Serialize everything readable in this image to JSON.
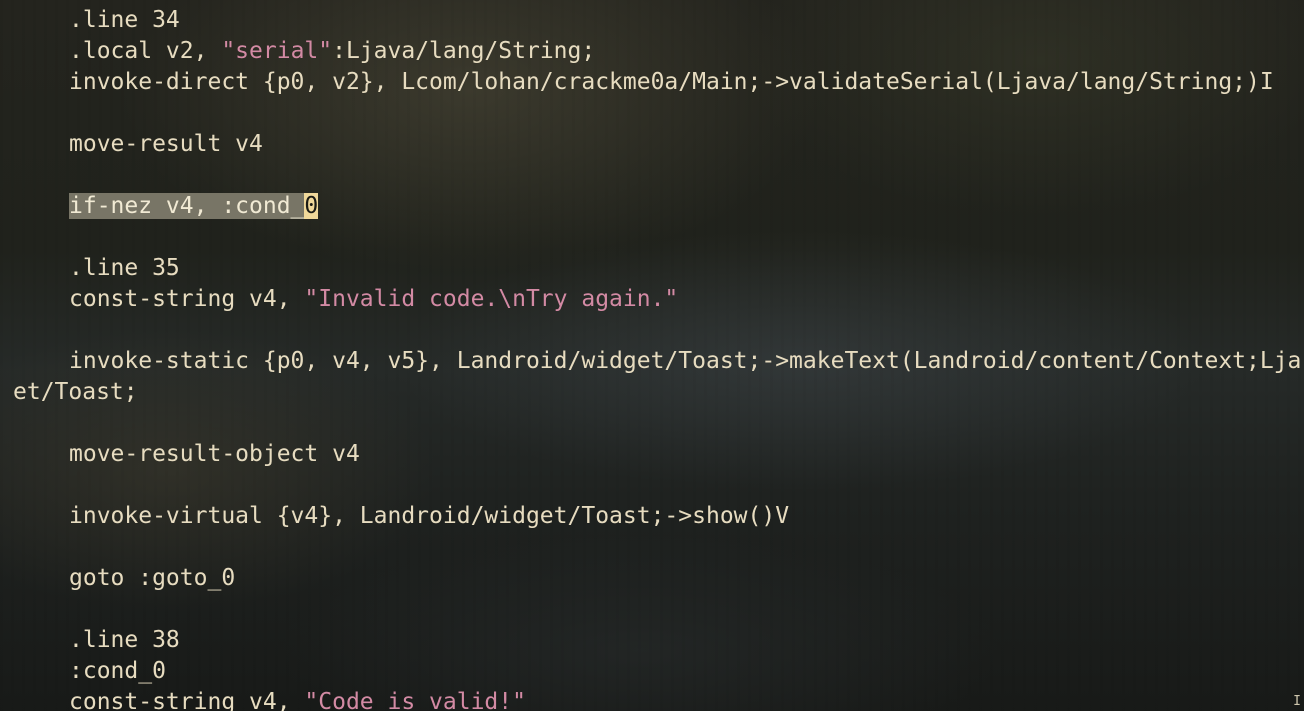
{
  "editor": {
    "lines": [
      {
        "text": ".line 34"
      },
      {
        "pre": ".local v2, ",
        "str": "\"serial\"",
        "post": ":Ljava/lang/String;"
      },
      {
        "text": "invoke-direct {p0, v2}, Lcom/lohan/crackme0a/Main;->validateSerial(Ljava/lang/String;)I"
      },
      {
        "text": ""
      },
      {
        "text": "move-result v4"
      },
      {
        "text": ""
      },
      {
        "selected": "if-nez v4, :cond_",
        "cursor": "0"
      },
      {
        "text": ""
      },
      {
        "text": ".line 35"
      },
      {
        "pre": "const-string v4, ",
        "str": "\"Invalid code.\\nTry again.\"",
        "post": ""
      },
      {
        "text": ""
      },
      {
        "text": "invoke-static {p0, v4, v5}, Landroid/widget/Toast;->makeText(Landroid/content/Context;Lja"
      },
      {
        "text": "et/Toast;"
      },
      {
        "text": ""
      },
      {
        "text": "move-result-object v4"
      },
      {
        "text": ""
      },
      {
        "text": "invoke-virtual {v4}, Landroid/widget/Toast;->show()V"
      },
      {
        "text": ""
      },
      {
        "text": "goto :goto_0"
      },
      {
        "text": ""
      },
      {
        "text": ".line 38"
      },
      {
        "text": ":cond_0"
      },
      {
        "pre": "const-string v4, ",
        "str": "\"Code is valid!\"",
        "post": ""
      }
    ],
    "edge_glyph": "I"
  },
  "colors": {
    "text": "#e7dcc0",
    "string_literal": "#d38aa4",
    "selection": "#787566",
    "cursor": "#f0d89a"
  }
}
